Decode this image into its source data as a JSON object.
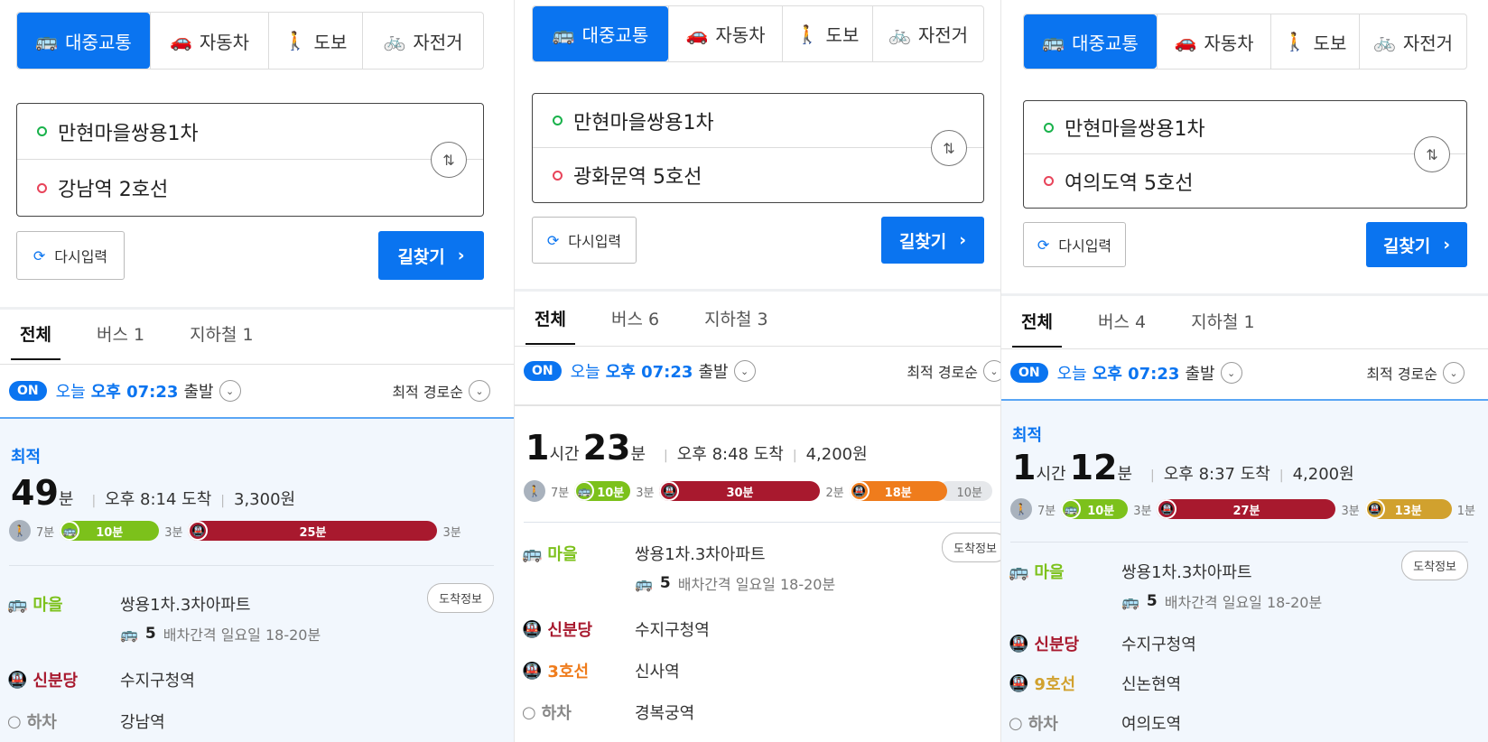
{
  "mode_tabs": {
    "transit": "대중교통",
    "car": "자동차",
    "walk": "도보",
    "bike": "자전거"
  },
  "icons": {
    "transit": "🚌",
    "car": "🚗",
    "walk": "🚶",
    "bike": "🚲",
    "swap": "⇅",
    "reset": "⟳",
    "arrow_right": "›",
    "chevron_down": "⌄"
  },
  "common": {
    "reset_label": "다시입력",
    "search_label": "길찾기",
    "tab_all": "전체",
    "on_badge": "ON",
    "time_prefix": "오늘",
    "time_value": "오후 07:23",
    "time_suffix": "출발",
    "sort_label": "최적 경로순",
    "best_label": "최적",
    "arrive_info": "도착정보",
    "unit_min": "분",
    "unit_hour": "시간",
    "lbl_village": "마을",
    "lbl_sinbundang": "신분당",
    "lbl_alight": "하차",
    "stop_from": "쌍용1차.3차아파트",
    "bus_no": "5",
    "bus_interval": "배차간격 일요일 18-20분",
    "stop_sinbundang": "수지구청역"
  },
  "panels": [
    {
      "origin": "만현마을쌍용1차",
      "destination": "강남역 2호선",
      "tab_bus": "버스 1",
      "tab_subway": "지하철 1",
      "duration_hours": "",
      "duration_minutes": "49",
      "arrival": "오후 8:14 도착",
      "fare": "3,300원",
      "timeline": {
        "walk": "7분",
        "bus": "10분",
        "gap1": "3분",
        "sub1": "25분",
        "gap2": "3분"
      },
      "alight": "강남역"
    },
    {
      "origin": "만현마을쌍용1차",
      "destination": "광화문역 5호선",
      "tab_bus": "버스 6",
      "tab_subway": "지하철 3",
      "duration_hours": "1",
      "duration_minutes": "23",
      "arrival": "오후 8:48 도착",
      "fare": "4,200원",
      "timeline": {
        "walk": "7분",
        "bus": "10분",
        "gap1": "3분",
        "sub1": "30분",
        "gap2": "2분",
        "sub2": "18분",
        "tail": "10분"
      },
      "line3_label": "3호선",
      "line3_stop": "신사역",
      "alight": "경복궁역"
    },
    {
      "origin": "만현마을쌍용1차",
      "destination": "여의도역 5호선",
      "tab_bus": "버스 4",
      "tab_subway": "지하철 1",
      "duration_hours": "1",
      "duration_minutes": "12",
      "arrival": "오후 8:37 도착",
      "fare": "4,200원",
      "timeline": {
        "walk": "7분",
        "bus": "10분",
        "gap1": "3분",
        "sub1": "27분",
        "gap2": "3분",
        "sub2": "13분",
        "tail": "1분"
      },
      "line9_label": "9호선",
      "line9_stop": "신논현역",
      "alight": "여의도역"
    }
  ],
  "colors": {
    "accent": "#0a74f0",
    "bus_green": "#7cc11b",
    "sinbundang_red": "#a8192e",
    "line3_orange": "#ef7c1c",
    "line9_gold": "#d1a12e",
    "walk_gray": "#a9b2bd"
  }
}
